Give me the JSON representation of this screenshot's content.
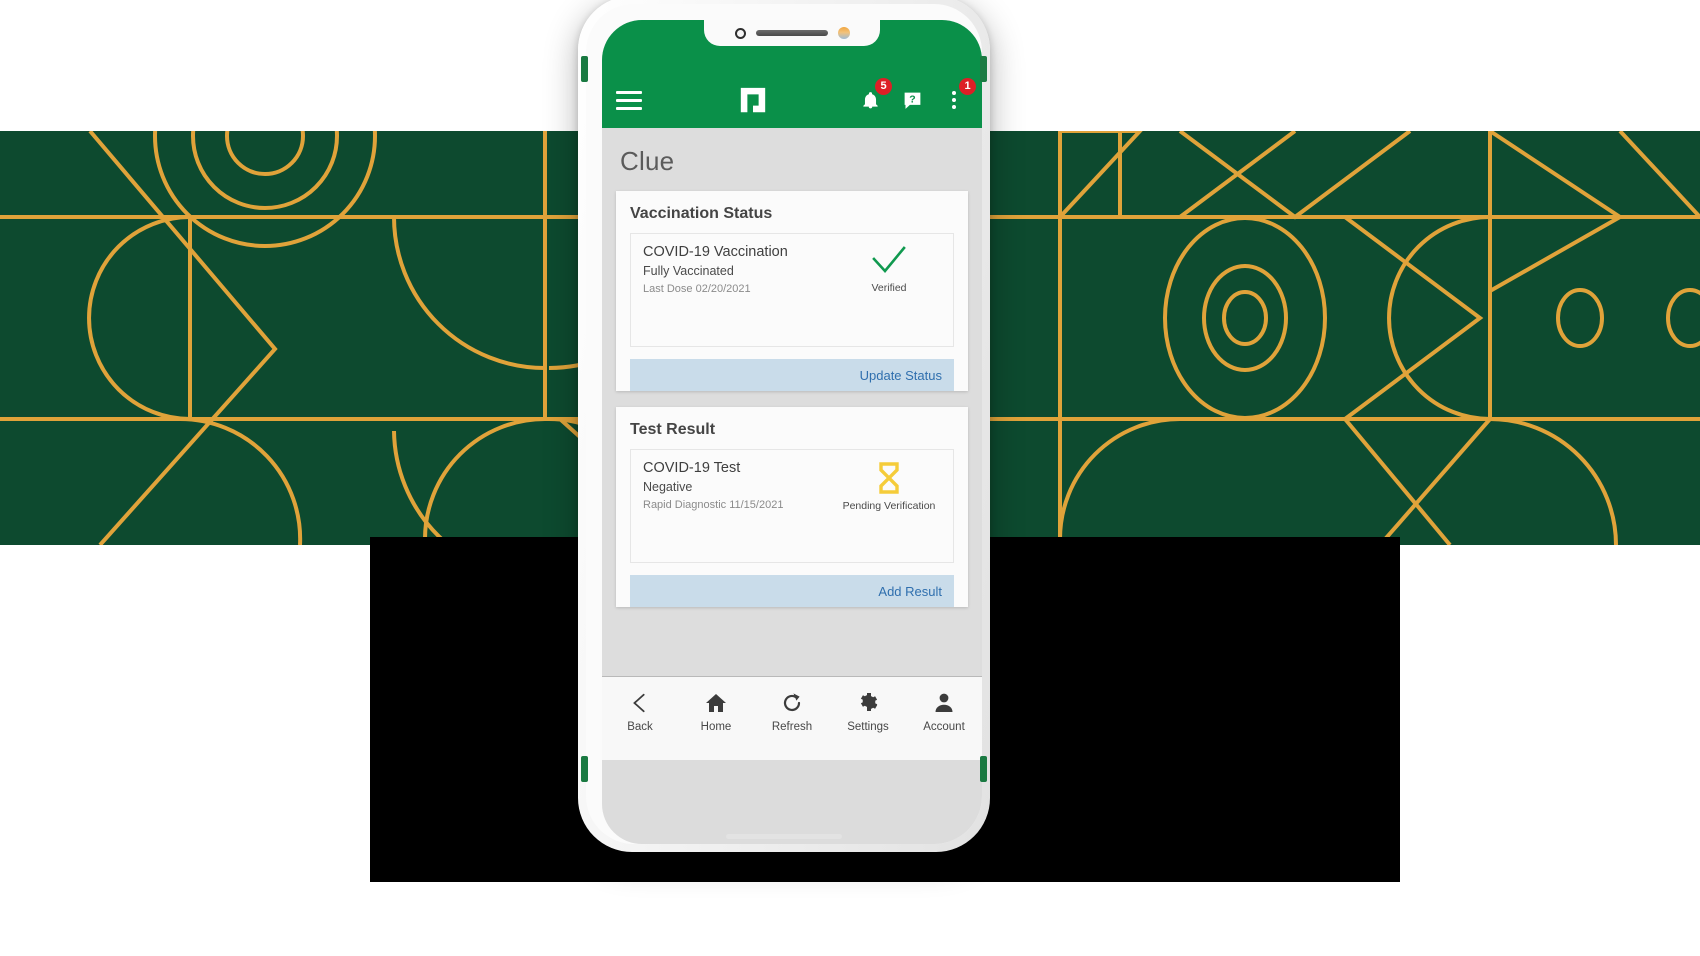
{
  "app": {
    "header": {
      "menu_icon": "hamburger-menu-icon",
      "logo_icon": "app-logo-icon",
      "notifications_icon": "bell-icon",
      "notifications_badge": "5",
      "help_icon": "help-question-icon",
      "overflow_icon": "kebab-menu-icon",
      "overflow_badge": "1",
      "background_color": "#0a9049"
    },
    "page_title": "Clue",
    "cards": [
      {
        "title": "Vaccination Status",
        "item_title": "COVID-19 Vaccination",
        "item_subtitle": "Fully Vaccinated",
        "item_meta": "Last Dose 02/20/2021",
        "status_icon": "check-mark-icon",
        "status_color": "#10994f",
        "status_label": "Verified",
        "action_label": "Update Status",
        "action_color": "#2f6fae",
        "action_background": "#c9dcea"
      },
      {
        "title": "Test Result",
        "item_title": "COVID-19 Test",
        "item_subtitle": "Negative",
        "item_meta": "Rapid Diagnostic 11/15/2021",
        "status_icon": "hourglass-icon",
        "status_color": "#f5cc3a",
        "status_label": "Pending Verification",
        "action_label": "Add Result",
        "action_color": "#2f6fae",
        "action_background": "#c9dcea"
      }
    ],
    "bottom_nav": [
      {
        "label": "Back",
        "icon": "chevron-left-icon"
      },
      {
        "label": "Home",
        "icon": "home-icon"
      },
      {
        "label": "Refresh",
        "icon": "refresh-icon"
      },
      {
        "label": "Settings",
        "icon": "gear-icon"
      },
      {
        "label": "Account",
        "icon": "person-icon"
      }
    ]
  },
  "decor": {
    "band_green": "#0d4a2f",
    "band_accent": "#e0a33a",
    "band_black": "#000000"
  }
}
